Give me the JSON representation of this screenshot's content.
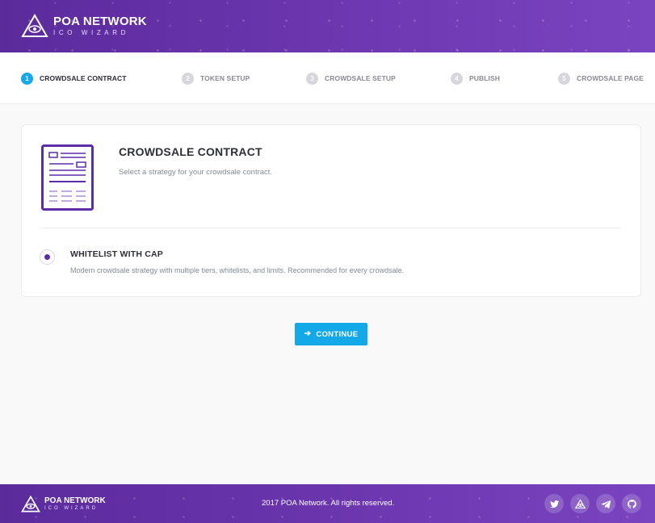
{
  "header": {
    "brand_title": "POA NETWORK",
    "brand_subtitle": "ICO WIZARD"
  },
  "steps": [
    {
      "number": "1",
      "label": "CROWDSALE CONTRACT",
      "active": true
    },
    {
      "number": "2",
      "label": "TOKEN SETUP",
      "active": false
    },
    {
      "number": "3",
      "label": "CROWDSALE SETUP",
      "active": false
    },
    {
      "number": "4",
      "label": "PUBLISH",
      "active": false
    },
    {
      "number": "5",
      "label": "CROWDSALE PAGE",
      "active": false
    }
  ],
  "card": {
    "icon": "document-icon",
    "title": "CROWDSALE CONTRACT",
    "description": "Select a strategy for your crowdsale contract.",
    "option": {
      "title": "WHITELIST WITH CAP",
      "description": "Modern crowdsale strategy with multiple tiers, whitelists, and limits. Recommended for every crowdsale.",
      "selected": true
    }
  },
  "continue_button": {
    "label": "CONTINUE",
    "icon": "arrow-right-icon"
  },
  "footer": {
    "brand_title": "POA NETWORK",
    "brand_subtitle": "ICO WIZARD",
    "copyright": "2017 POA Network. All rights reserved.",
    "social": [
      "twitter-icon",
      "poa-icon",
      "telegram-icon",
      "github-icon"
    ]
  },
  "colors": {
    "brand_purple": "#6a35ad",
    "accent_blue": "#13a8e7",
    "radio_purple": "#5d2ca8"
  }
}
